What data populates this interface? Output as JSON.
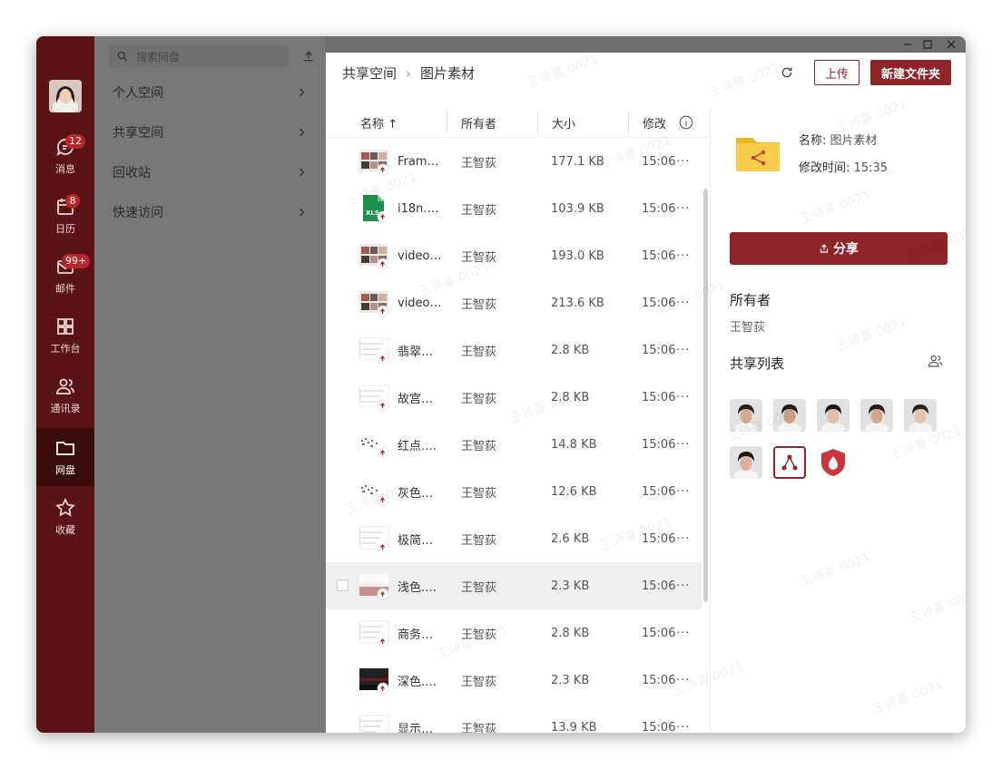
{
  "rail": {
    "items": [
      {
        "label": "消息",
        "badge": "12",
        "icon": "message-icon"
      },
      {
        "label": "日历",
        "badge": "8",
        "icon": "calendar-icon"
      },
      {
        "label": "邮件",
        "badge": "99+",
        "icon": "mail-icon"
      },
      {
        "label": "工作台",
        "badge": "",
        "icon": "grid-icon"
      },
      {
        "label": "通讯录",
        "badge": "",
        "icon": "contacts-icon"
      },
      {
        "label": "网盘",
        "badge": "",
        "icon": "folder-icon"
      },
      {
        "label": "收藏",
        "badge": "",
        "icon": "star-icon"
      }
    ]
  },
  "sidebar": {
    "search_placeholder": "搜索网盘",
    "items": [
      {
        "label": "个人空间"
      },
      {
        "label": "共享空间"
      },
      {
        "label": "回收站"
      },
      {
        "label": "快速访问"
      }
    ]
  },
  "header": {
    "crumb_root": "共享空间",
    "crumb_current": "图片素材",
    "upload_label": "上传",
    "new_folder_label": "新建文件夹"
  },
  "table": {
    "columns": {
      "name": "名称 ↑",
      "owner": "所有者",
      "size": "大小",
      "modified": "修改"
    },
    "rows": [
      {
        "name": "Fram…",
        "owner": "王智荻",
        "size": "177.1 KB",
        "modified": "15:06",
        "thumb": "photo"
      },
      {
        "name": "i18n.…",
        "owner": "王智荻",
        "size": "103.9 KB",
        "modified": "15:06",
        "thumb": "xls"
      },
      {
        "name": "video…",
        "owner": "王智荻",
        "size": "193.0 KB",
        "modified": "15:06",
        "thumb": "photo"
      },
      {
        "name": "video…",
        "owner": "王智荻",
        "size": "213.6 KB",
        "modified": "15:06",
        "thumb": "photo"
      },
      {
        "name": "翡翠…",
        "owner": "王智荻",
        "size": "2.8 KB",
        "modified": "15:06",
        "thumb": "doc"
      },
      {
        "name": "故宫…",
        "owner": "王智荻",
        "size": "2.8 KB",
        "modified": "15:06",
        "thumb": "doc"
      },
      {
        "name": "红点.…",
        "owner": "王智荻",
        "size": "14.8 KB",
        "modified": "15:06",
        "thumb": "dots"
      },
      {
        "name": "灰色…",
        "owner": "王智荻",
        "size": "12.6 KB",
        "modified": "15:06",
        "thumb": "dots"
      },
      {
        "name": "极简…",
        "owner": "王智荻",
        "size": "2.6 KB",
        "modified": "15:06",
        "thumb": "doc"
      },
      {
        "name": "浅色.…",
        "owner": "王智荻",
        "size": "2.3 KB",
        "modified": "15:06",
        "thumb": "light"
      },
      {
        "name": "商务…",
        "owner": "王智荻",
        "size": "2.8 KB",
        "modified": "15:06",
        "thumb": "doc"
      },
      {
        "name": "深色.…",
        "owner": "王智荻",
        "size": "2.3 KB",
        "modified": "15:06",
        "thumb": "dark"
      },
      {
        "name": "显示…",
        "owner": "王智荻",
        "size": "13.9 KB",
        "modified": "15:06",
        "thumb": "doc"
      }
    ],
    "more_label": "···"
  },
  "detail": {
    "name_label": "名称:",
    "name_value": "图片素材",
    "time_label": "修改时间:",
    "time_value": "15:35",
    "share_label": "分享",
    "owner_title": "所有者",
    "owner_value": "王智荻",
    "share_list_title": "共享列表"
  },
  "watermark": "王诗蔓 0021",
  "colors": {
    "brand": "#8c2428",
    "rail": "#5a1416",
    "rail_active": "#3a0c0e"
  }
}
